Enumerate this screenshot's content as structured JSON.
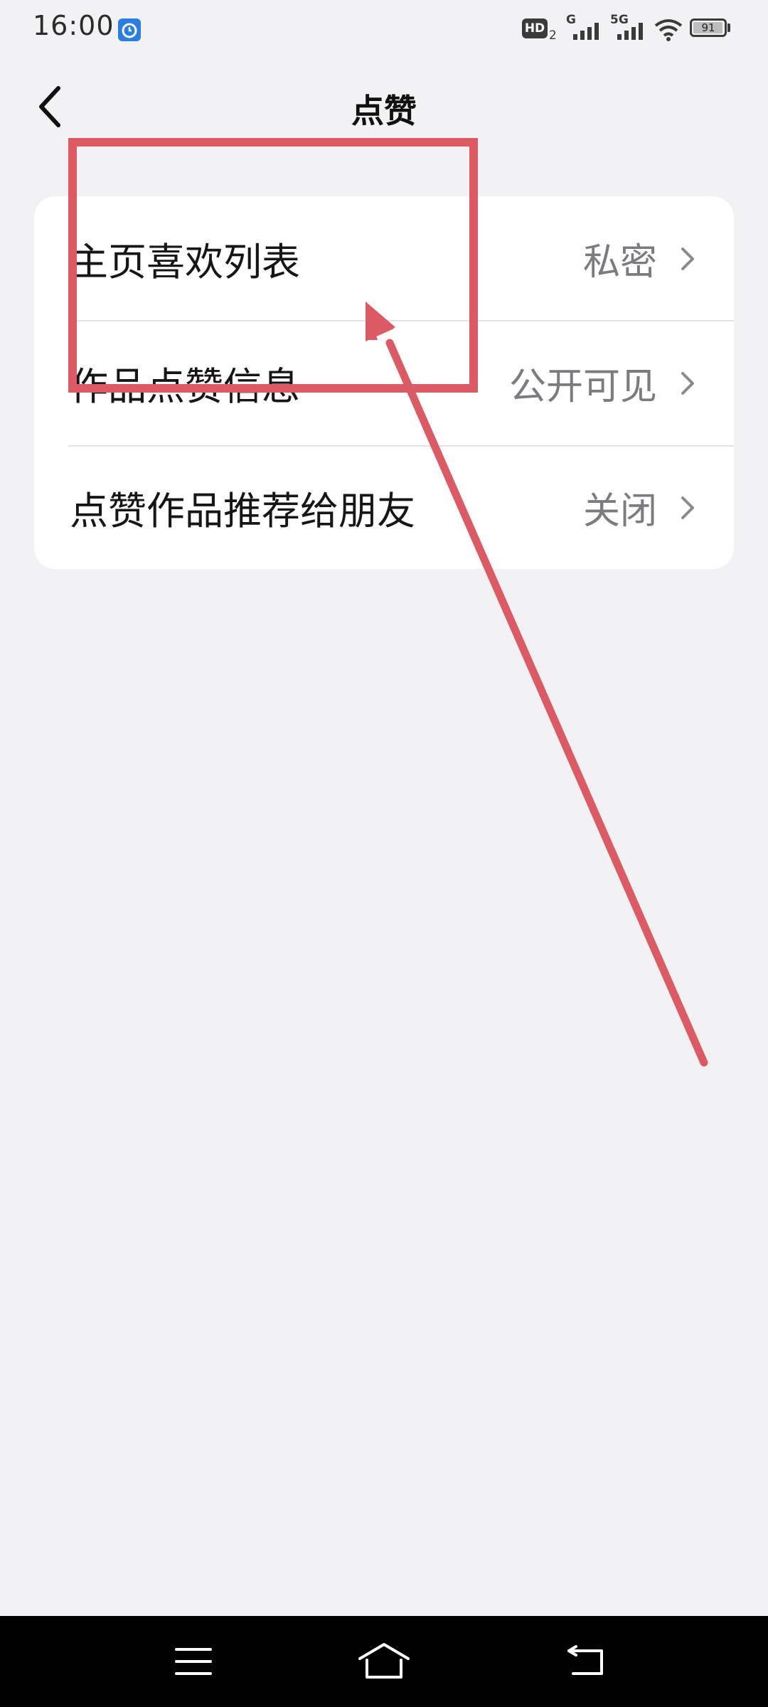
{
  "status_bar": {
    "time": "16:00",
    "network_badge": "HD",
    "sim_slot": "2",
    "signal1_label": "G",
    "signal2_label": "5G",
    "battery": "91"
  },
  "header": {
    "title": "点赞"
  },
  "settings": [
    {
      "label": "主页喜欢列表",
      "value": "私密"
    },
    {
      "label": "作品点赞信息",
      "value": "公开可见"
    },
    {
      "label": "点赞作品推荐给朋友",
      "value": "关闭"
    }
  ],
  "colors": {
    "background": "#f2f1f3",
    "card": "#ffffff",
    "annotation": "#dc5a63",
    "nav_bar": "#000000"
  },
  "icons": {
    "back": "chevron-left-icon",
    "row_chevron": "chevron-right-icon",
    "nav_menu": "menu-icon",
    "nav_home": "home-icon",
    "nav_back": "back-icon"
  }
}
